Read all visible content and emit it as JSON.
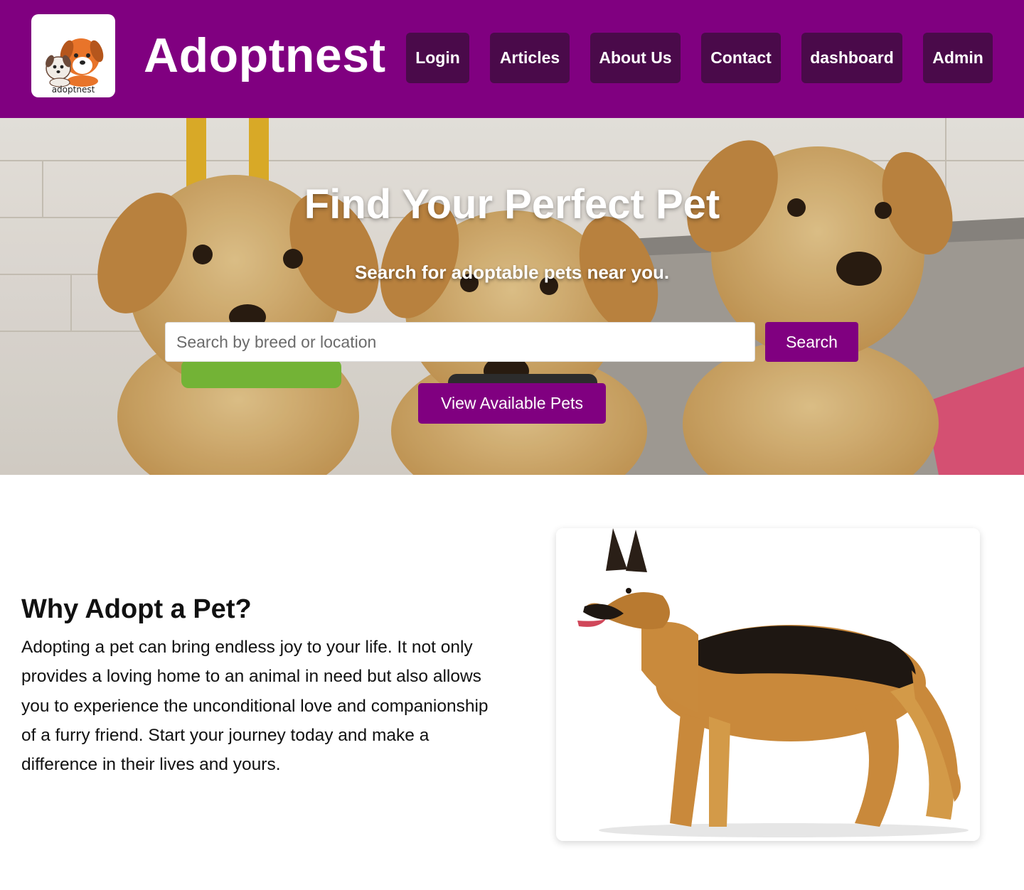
{
  "header": {
    "logo_text": "adoptnest",
    "brand": "Adoptnest",
    "nav": [
      "Login",
      "Articles",
      "About Us",
      "Contact",
      "dashboard",
      "Admin"
    ]
  },
  "hero": {
    "title": "Find Your Perfect Pet",
    "subtitle": "Search for adoptable pets near you.",
    "search_placeholder": "Search by breed or location",
    "search_label": "Search",
    "view_label": "View Available Pets"
  },
  "why": {
    "heading": "Why Adopt a Pet?",
    "text": "Adopting a pet can bring endless joy to your life. It not only provides a loving home to an animal in need but also allows you to experience the unconditional love and companionship of a furry friend. Start your journey today and make a difference in their lives and yours."
  },
  "colors": {
    "brand_purple": "#800080",
    "nav_button": "#4a0a4a"
  }
}
